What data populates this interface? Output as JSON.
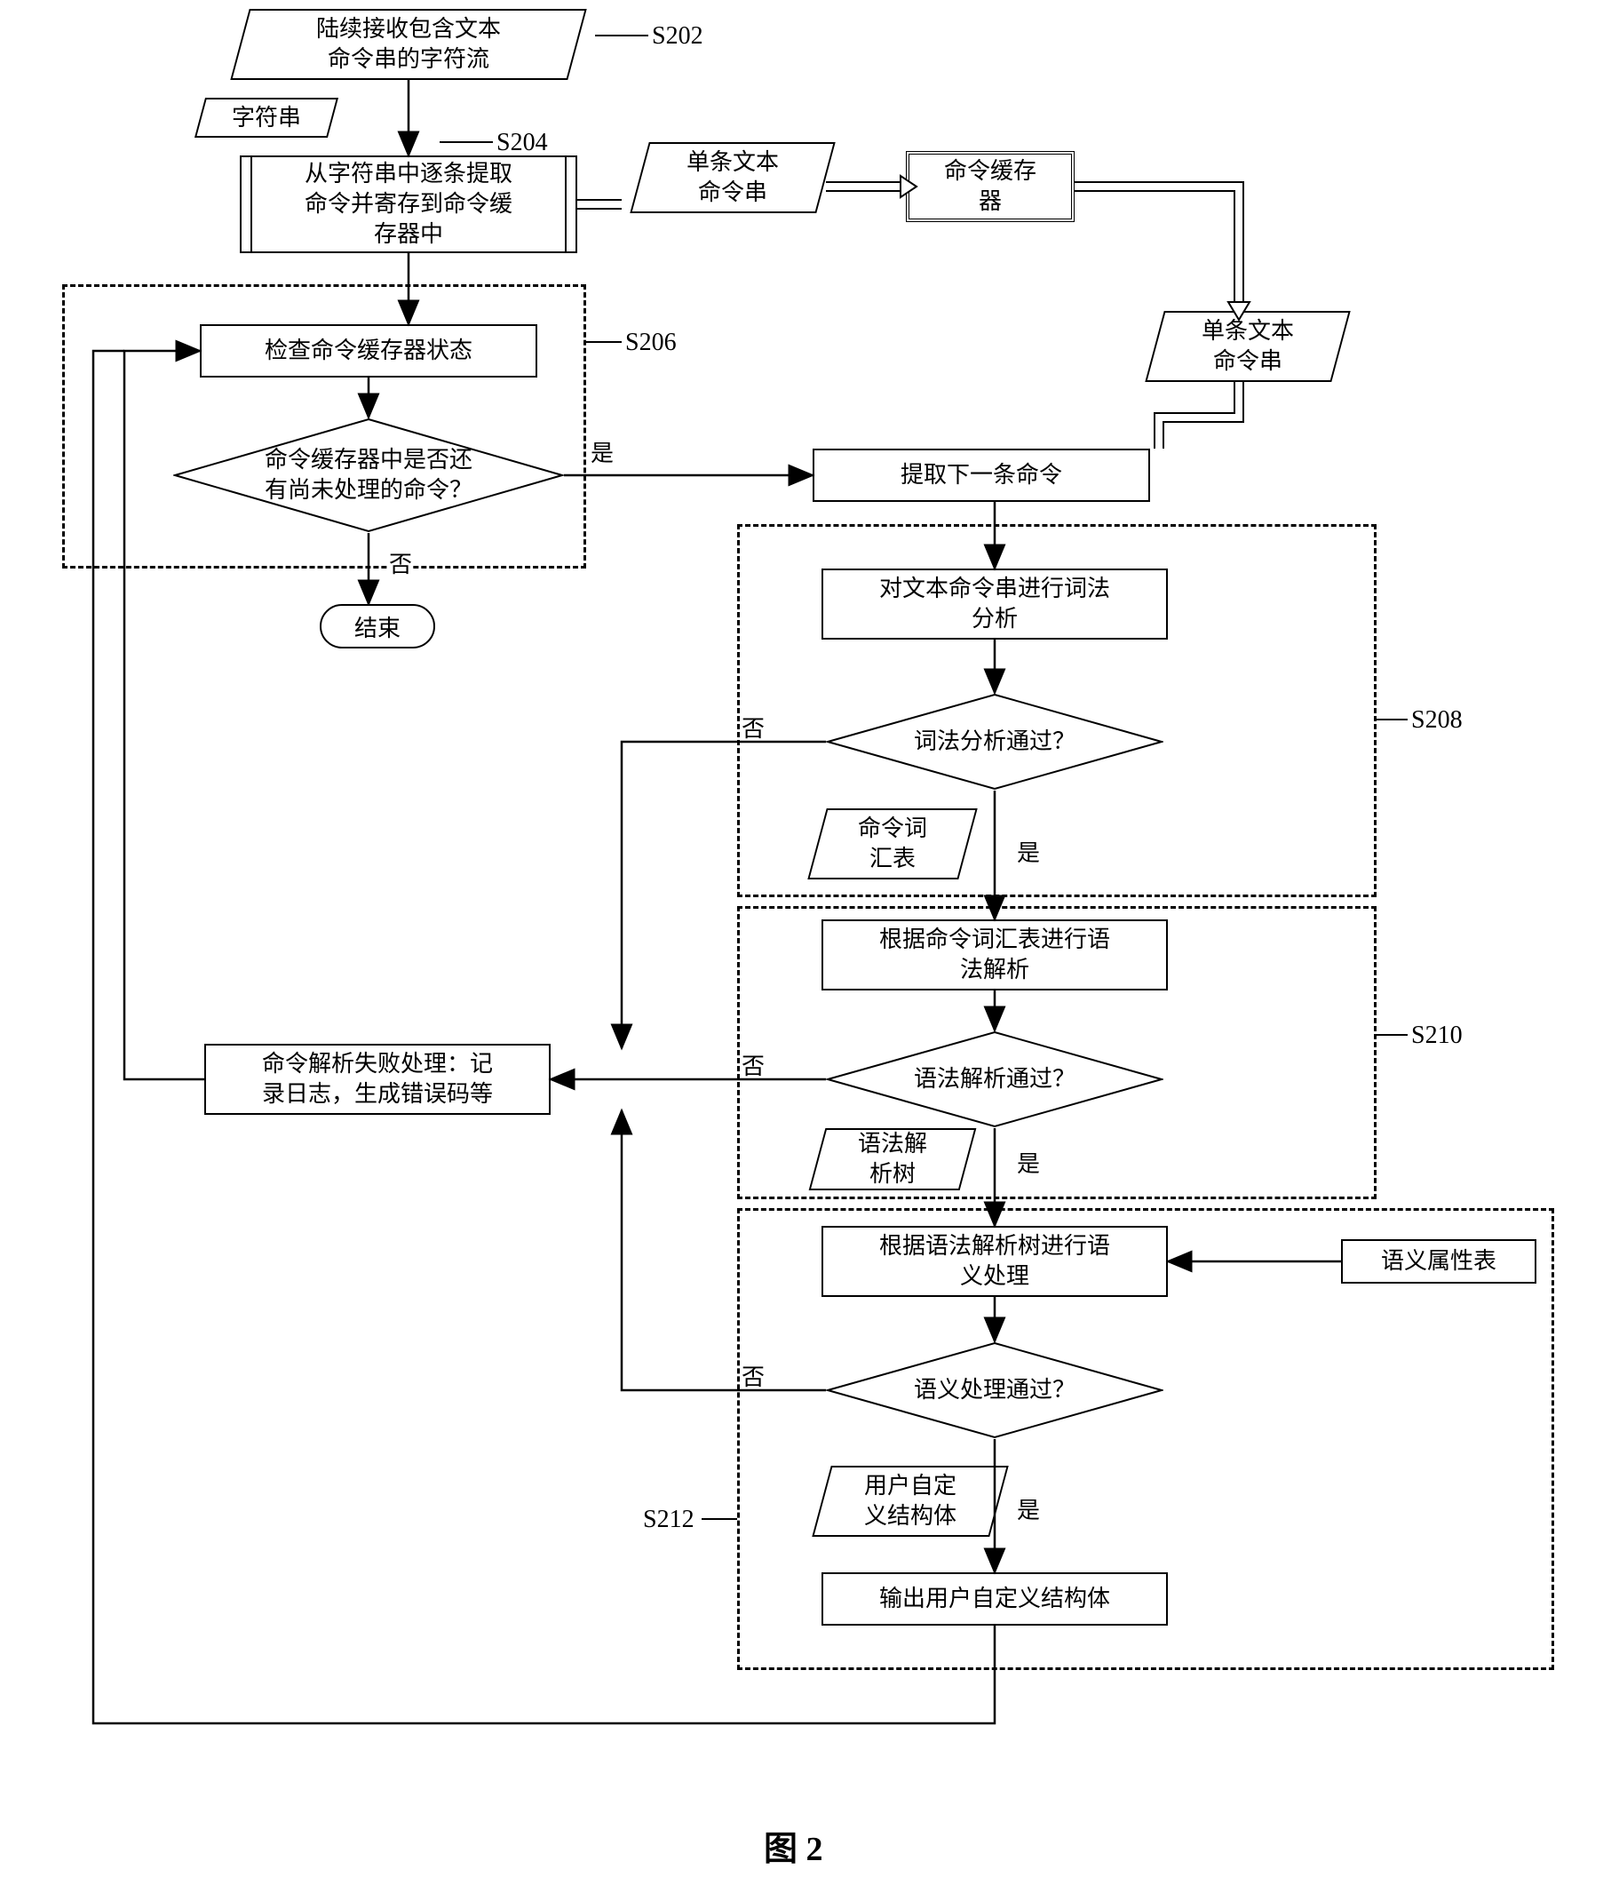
{
  "nodes": {
    "n1": "陆续接收包含文本\n命令串的字符流",
    "d1": "字符串",
    "n2": "从字符串中逐条提取\n命令并寄存到命令缓\n存器中",
    "d2": "单条文本\n命令串",
    "nbuf": "命令缓存\n器",
    "d2b": "单条文本\n命令串",
    "n3": "检查命令缓存器状态",
    "q1": "命令缓存器中是否还\n有尚未处理的命令？",
    "end": "结束",
    "n4": "提取下一条命令",
    "n5": "对文本命令串进行词法\n分析",
    "q2": "词法分析通过？",
    "d3": "命令词\n汇表",
    "n6": "根据命令词汇表进行语\n法解析",
    "q3": "语法解析通过？",
    "d4": "语法解\n析树",
    "n7": "根据语法解析树进行语\n义处理",
    "nattr": "语义属性表",
    "q4": "语义处理通过？",
    "d5": "用户自定\n义结构体",
    "n8": "输出用户自定义结构体",
    "nfail": "命令解析失败处理：记\n录日志，生成错误码等"
  },
  "stepLabels": {
    "s202": "S202",
    "s204": "S204",
    "s206": "S206",
    "s208": "S208",
    "s210": "S210",
    "s212": "S212"
  },
  "edgeLabels": {
    "yes": "是",
    "no": "否"
  },
  "figure": "图 2"
}
